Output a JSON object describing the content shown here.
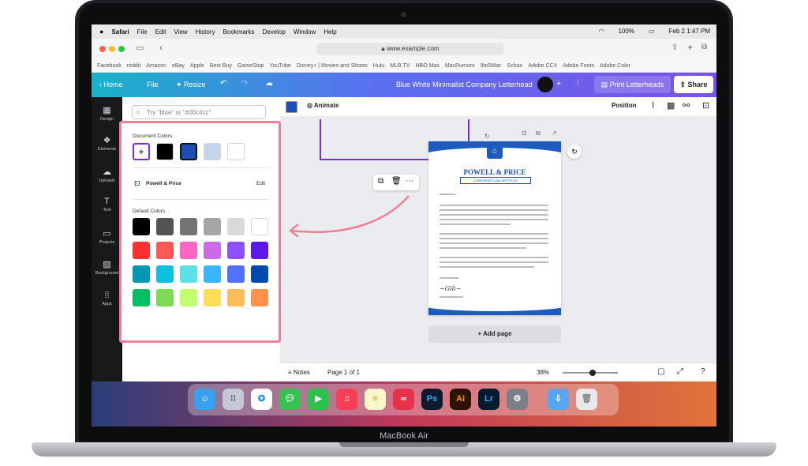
{
  "laptop": {
    "brand": "MacBook Air"
  },
  "menubar": {
    "apple": "",
    "items": [
      "Safari",
      "File",
      "Edit",
      "View",
      "History",
      "Bookmarks",
      "Develop",
      "Window",
      "Help"
    ],
    "battery": "100%",
    "datetime": "Feb 2  1:47 PM"
  },
  "safari": {
    "url": "www.example.com"
  },
  "bookmarks": [
    "Facebook",
    "reddit",
    "Amazon",
    "eBay",
    "Apple",
    "Best Buy",
    "GameStop",
    "YouTube",
    "Disney+ | Movies and Shows",
    "Hulu",
    "MLB.TV",
    "HBO Max",
    "MacRumors",
    "9to5Mac",
    "Schoo",
    "Adobe CCX",
    "Adobe Fonts",
    "Adobe Color"
  ],
  "canva": {
    "home": "Home",
    "file": "File",
    "resize": "Resize",
    "doc_title": "Blue White Minimalist Company Letterhead",
    "print": "Print Letterheads",
    "share": "Share"
  },
  "rail": [
    "Design",
    "Elements",
    "Uploads",
    "Text",
    "Projects",
    "Background",
    "Apps"
  ],
  "panel": {
    "search_placeholder": "Try \"blue\" or \"#00c4cc\""
  },
  "toolbar": {
    "animate": "Animate",
    "position": "Position"
  },
  "colors": {
    "document_title": "Document Colors",
    "document": [
      "#000000",
      "#1d4fb3",
      "#c5d4ea",
      "#ffffff"
    ],
    "brand_name": "Powell & Price",
    "edit": "Edit",
    "default_title": "Default Colors",
    "default": [
      [
        "#000000",
        "#545454",
        "#737373",
        "#a6a6a6",
        "#d9d9d9",
        "#ffffff"
      ],
      [
        "#ff3131",
        "#ff5757",
        "#ff66c4",
        "#cb6ce6",
        "#8c52ff",
        "#5e17eb"
      ],
      [
        "#0097b2",
        "#0cc0df",
        "#5ce1e6",
        "#38b6ff",
        "#5271ff",
        "#004aad"
      ],
      [
        "#00bf63",
        "#7ed957",
        "#c1ff72",
        "#ffde59",
        "#ffbd59",
        "#ff914d"
      ]
    ]
  },
  "letter": {
    "company": "POWELL & PRICE",
    "tagline": "CORPORATE LAW INSTITUTE"
  },
  "add_page": "+ Add page",
  "footer": {
    "notes": "Notes",
    "page": "Page 1 of 1",
    "zoom": "38%"
  },
  "dock": [
    "Finder",
    "Launchpad",
    "Safari",
    "Messages",
    "FaceTime",
    "Music",
    "Notes",
    "Creative Cloud",
    "Ps",
    "Ai",
    "Lr",
    "System Settings",
    "Downloads",
    "Trash"
  ]
}
